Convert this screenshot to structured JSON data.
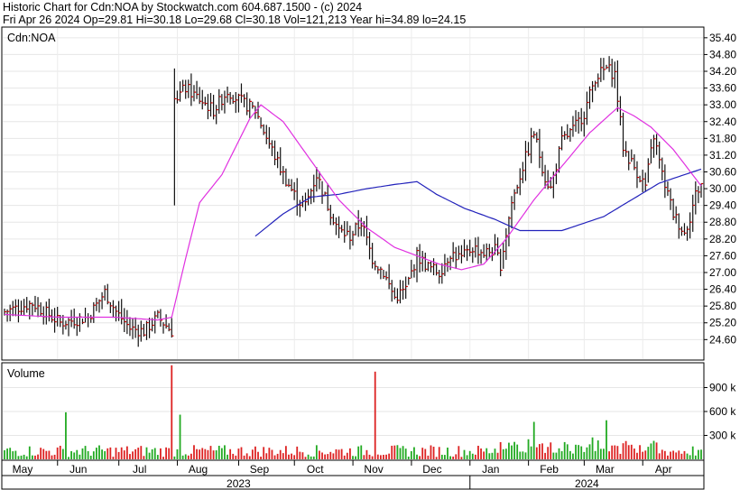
{
  "header": {
    "line1": "Historic Chart for Cdn:NOA by Stockwatch.com 604.687.1500 - (c) 2024",
    "line2": "Fri Apr 26 2024   Op=29.81   Hi=30.18   Lo=29.68   Cl=30.18   Vol=121,213   Year hi=34.89   lo=24.15"
  },
  "chart_data": [
    {
      "type": "ohlc",
      "symbol_label": "Cdn:NOA",
      "y_ticks": [
        24.6,
        25.2,
        25.8,
        26.4,
        27.0,
        27.6,
        28.2,
        28.8,
        29.4,
        30.0,
        30.6,
        31.2,
        31.8,
        32.4,
        33.0,
        33.6,
        34.2,
        34.8,
        35.4
      ],
      "ylim": [
        23.9,
        35.75
      ],
      "x_month_labels": [
        "May",
        "Jun",
        "Jul",
        "Aug",
        "Sep",
        "Oct",
        "Nov",
        "Dec",
        "Jan",
        "Feb",
        "Mar",
        "Apr"
      ],
      "x_year_labels": [
        "2023",
        "2024"
      ],
      "close_keypoints": [
        [
          0,
          25.6
        ],
        [
          10,
          25.9
        ],
        [
          20,
          25.2
        ],
        [
          30,
          25.4
        ],
        [
          36,
          26.3
        ],
        [
          40,
          25.6
        ],
        [
          45,
          25.0
        ],
        [
          50,
          24.9
        ],
        [
          55,
          25.4
        ],
        [
          60,
          24.9
        ],
        [
          61,
          33.2
        ],
        [
          65,
          33.6
        ],
        [
          70,
          33.2
        ],
        [
          75,
          32.8
        ],
        [
          80,
          33.5
        ],
        [
          85,
          33.1
        ],
        [
          90,
          32.8
        ],
        [
          95,
          31.6
        ],
        [
          100,
          30.5
        ],
        [
          105,
          29.6
        ],
        [
          108,
          29.4
        ],
        [
          112,
          30.5
        ],
        [
          116,
          29.4
        ],
        [
          120,
          28.5
        ],
        [
          124,
          28.3
        ],
        [
          128,
          28.8
        ],
        [
          132,
          27.5
        ],
        [
          136,
          27.0
        ],
        [
          140,
          26.1
        ],
        [
          144,
          26.4
        ],
        [
          148,
          27.6
        ],
        [
          152,
          27.2
        ],
        [
          156,
          27.0
        ],
        [
          160,
          27.7
        ],
        [
          164,
          27.5
        ],
        [
          168,
          27.9
        ],
        [
          172,
          27.7
        ],
        [
          176,
          27.8
        ],
        [
          178,
          27.3
        ],
        [
          182,
          29.5
        ],
        [
          186,
          30.8
        ],
        [
          190,
          32.0
        ],
        [
          194,
          30.4
        ],
        [
          196,
          30.0
        ],
        [
          200,
          31.7
        ],
        [
          204,
          32.1
        ],
        [
          208,
          32.7
        ],
        [
          212,
          34.0
        ],
        [
          216,
          34.3
        ],
        [
          219,
          34.1
        ],
        [
          222,
          31.5
        ],
        [
          224,
          31.1
        ],
        [
          227,
          30.6
        ],
        [
          230,
          30.1
        ],
        [
          233,
          31.9
        ],
        [
          236,
          30.5
        ],
        [
          240,
          29.1
        ],
        [
          244,
          28.4
        ],
        [
          246,
          29.0
        ],
        [
          248,
          29.8
        ],
        [
          250,
          30.18
        ]
      ],
      "ma_long_keypoints": [
        [
          90,
          28.3
        ],
        [
          100,
          29.1
        ],
        [
          110,
          29.7
        ],
        [
          120,
          29.8
        ],
        [
          130,
          30.0
        ],
        [
          140,
          30.15
        ],
        [
          148,
          30.25
        ],
        [
          155,
          29.8
        ],
        [
          165,
          29.3
        ],
        [
          176,
          28.9
        ],
        [
          185,
          28.5
        ],
        [
          200,
          28.5
        ],
        [
          215,
          29.0
        ],
        [
          225,
          29.6
        ],
        [
          235,
          30.2
        ],
        [
          250,
          30.7
        ]
      ],
      "ma_short_keypoints": [
        [
          0,
          25.5
        ],
        [
          20,
          25.4
        ],
        [
          40,
          25.4
        ],
        [
          55,
          25.3
        ],
        [
          60,
          25.4
        ],
        [
          65,
          27.5
        ],
        [
          70,
          29.5
        ],
        [
          78,
          30.5
        ],
        [
          88,
          32.5
        ],
        [
          92,
          33.0
        ],
        [
          100,
          32.4
        ],
        [
          110,
          31.0
        ],
        [
          120,
          29.6
        ],
        [
          130,
          28.6
        ],
        [
          140,
          27.9
        ],
        [
          148,
          27.6
        ],
        [
          156,
          27.3
        ],
        [
          164,
          27.1
        ],
        [
          172,
          27.3
        ],
        [
          180,
          28.2
        ],
        [
          190,
          29.6
        ],
        [
          200,
          30.8
        ],
        [
          210,
          32.0
        ],
        [
          220,
          32.9
        ],
        [
          226,
          32.6
        ],
        [
          232,
          32.2
        ],
        [
          240,
          31.4
        ],
        [
          250,
          30.1
        ]
      ],
      "colors": {
        "bars": "#111111",
        "ma_short": "#e030e0",
        "ma_long": "#2222bb",
        "close_tick": "#cc0000"
      }
    },
    {
      "type": "bar",
      "title": "Volume",
      "y_ticks": [
        "900 k",
        "600 k",
        "300 k"
      ],
      "y_tick_values": [
        900,
        600,
        300
      ],
      "ylim": [
        0,
        1200
      ],
      "spikes_k": [
        [
          22,
          590
        ],
        [
          60,
          1180
        ],
        [
          63,
          560
        ],
        [
          133,
          1100
        ],
        [
          216,
          490
        ],
        [
          190,
          470
        ]
      ],
      "colors": {
        "up": "#22aa22",
        "down": "#dd2222"
      }
    }
  ]
}
